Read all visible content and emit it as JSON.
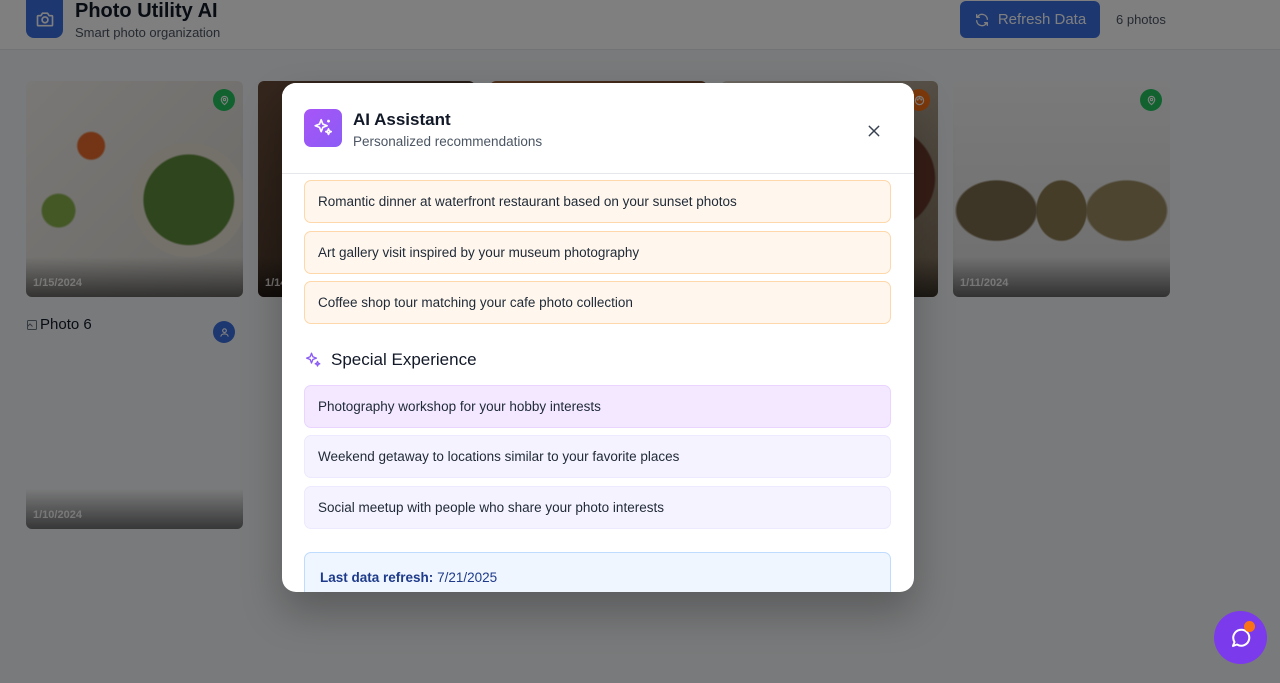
{
  "header": {
    "title": "Photo Utility AI",
    "subtitle": "Smart photo organization",
    "refresh_label": "Refresh Data",
    "photo_count": "6 photos",
    "logo_icon": "camera-icon"
  },
  "photos": [
    {
      "date": "1/15/2024",
      "badge": "location-pin-icon",
      "badge_color": "#22c55e"
    },
    {
      "date": "1/14/2024",
      "badge": "",
      "badge_color": ""
    },
    {
      "date": "",
      "badge": "",
      "badge_color": ""
    },
    {
      "date": "",
      "badge": "palette-icon",
      "badge_color": "#f97316"
    },
    {
      "date": "1/11/2024",
      "badge": "location-pin-icon",
      "badge_color": "#22c55e"
    },
    {
      "date": "1/10/2024",
      "alt": "Photo 6",
      "badge": "user-icon",
      "badge_color": "#3b6fe0"
    }
  ],
  "modal": {
    "title": "AI Assistant",
    "subtitle": "Personalized recommendations",
    "recommendations": [
      "Romantic dinner at waterfront restaurant based on your sunset photos",
      "Art gallery visit inspired by your museum photography",
      "Coffee shop tour matching your cafe photo collection"
    ],
    "special_title": "Special Experience",
    "special_items": [
      "Photography workshop for your hobby interests",
      "Weekend getaway to locations similar to your favorite places",
      "Social meetup with people who share your photo interests"
    ],
    "refresh_label": "Last data refresh:",
    "refresh_date": "7/21/2025"
  },
  "colors": {
    "primary": "#3b6fe0",
    "accent_purple": "#8b5cf6",
    "accent_orange": "#f97316"
  }
}
